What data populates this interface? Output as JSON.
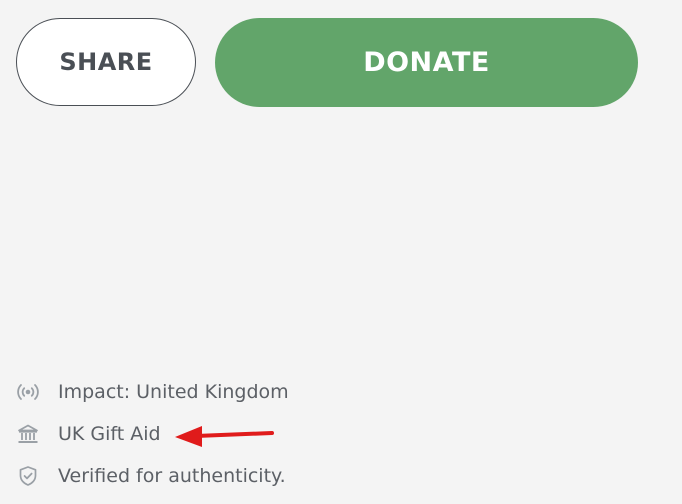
{
  "actions": {
    "share_label": "SHARE",
    "donate_label": "DONATE"
  },
  "info_list": [
    {
      "icon": "broadcast-icon",
      "label": "Impact: United Kingdom"
    },
    {
      "icon": "bank-icon",
      "label": "UK Gift Aid"
    },
    {
      "icon": "shield-check-icon",
      "label": "Verified for authenticity."
    }
  ],
  "colors": {
    "donate_green": "#62a56a",
    "text_gray": "#5c6066",
    "annotation_red": "#e01b1b"
  }
}
